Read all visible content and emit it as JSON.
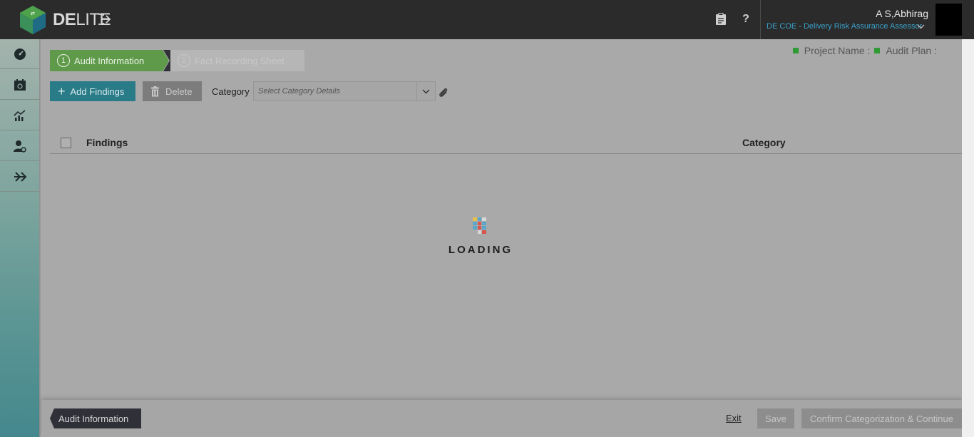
{
  "app": {
    "logo_bold": "DE",
    "logo_light": "LITE"
  },
  "header": {
    "clipboard_icon": "clipboard-icon",
    "help_icon": "help-icon",
    "help_label": "?",
    "user_name": "A S,Abhirag",
    "user_role": "DE COE - Delivery Risk Assurance Assessor"
  },
  "sidebar": {
    "items": [
      {
        "icon": "dashboard-icon"
      },
      {
        "icon": "calendar-icon"
      },
      {
        "icon": "analytics-icon"
      },
      {
        "icon": "user-settings-icon"
      },
      {
        "icon": "workflow-icon"
      }
    ]
  },
  "stepper": {
    "step1_num": "1",
    "step1_label": "Audit Information",
    "step2_num": "2",
    "step2_label": "Fact Recording Sheet"
  },
  "project_info": {
    "project_name_label": "Project Name :",
    "audit_plan_label": "Audit Plan :"
  },
  "toolbar": {
    "add_findings_label": "Add Findings",
    "delete_label": "Delete",
    "category_label": "Category",
    "category_placeholder": "Select Category Details"
  },
  "table": {
    "columns": [
      "Findings",
      "Category"
    ]
  },
  "loading": {
    "text": "LOADING"
  },
  "footer": {
    "tag_label": "Audit Information",
    "exit_label": "Exit",
    "save_label": "Save",
    "confirm_label": "Confirm Categorization & Continue"
  },
  "colors": {
    "header_bg": "#2b2b2b",
    "step_active": "#5f9a4a",
    "add_button": "#2a7b88",
    "role_text": "#3aa0c8",
    "project_square": "#2f9a35"
  }
}
